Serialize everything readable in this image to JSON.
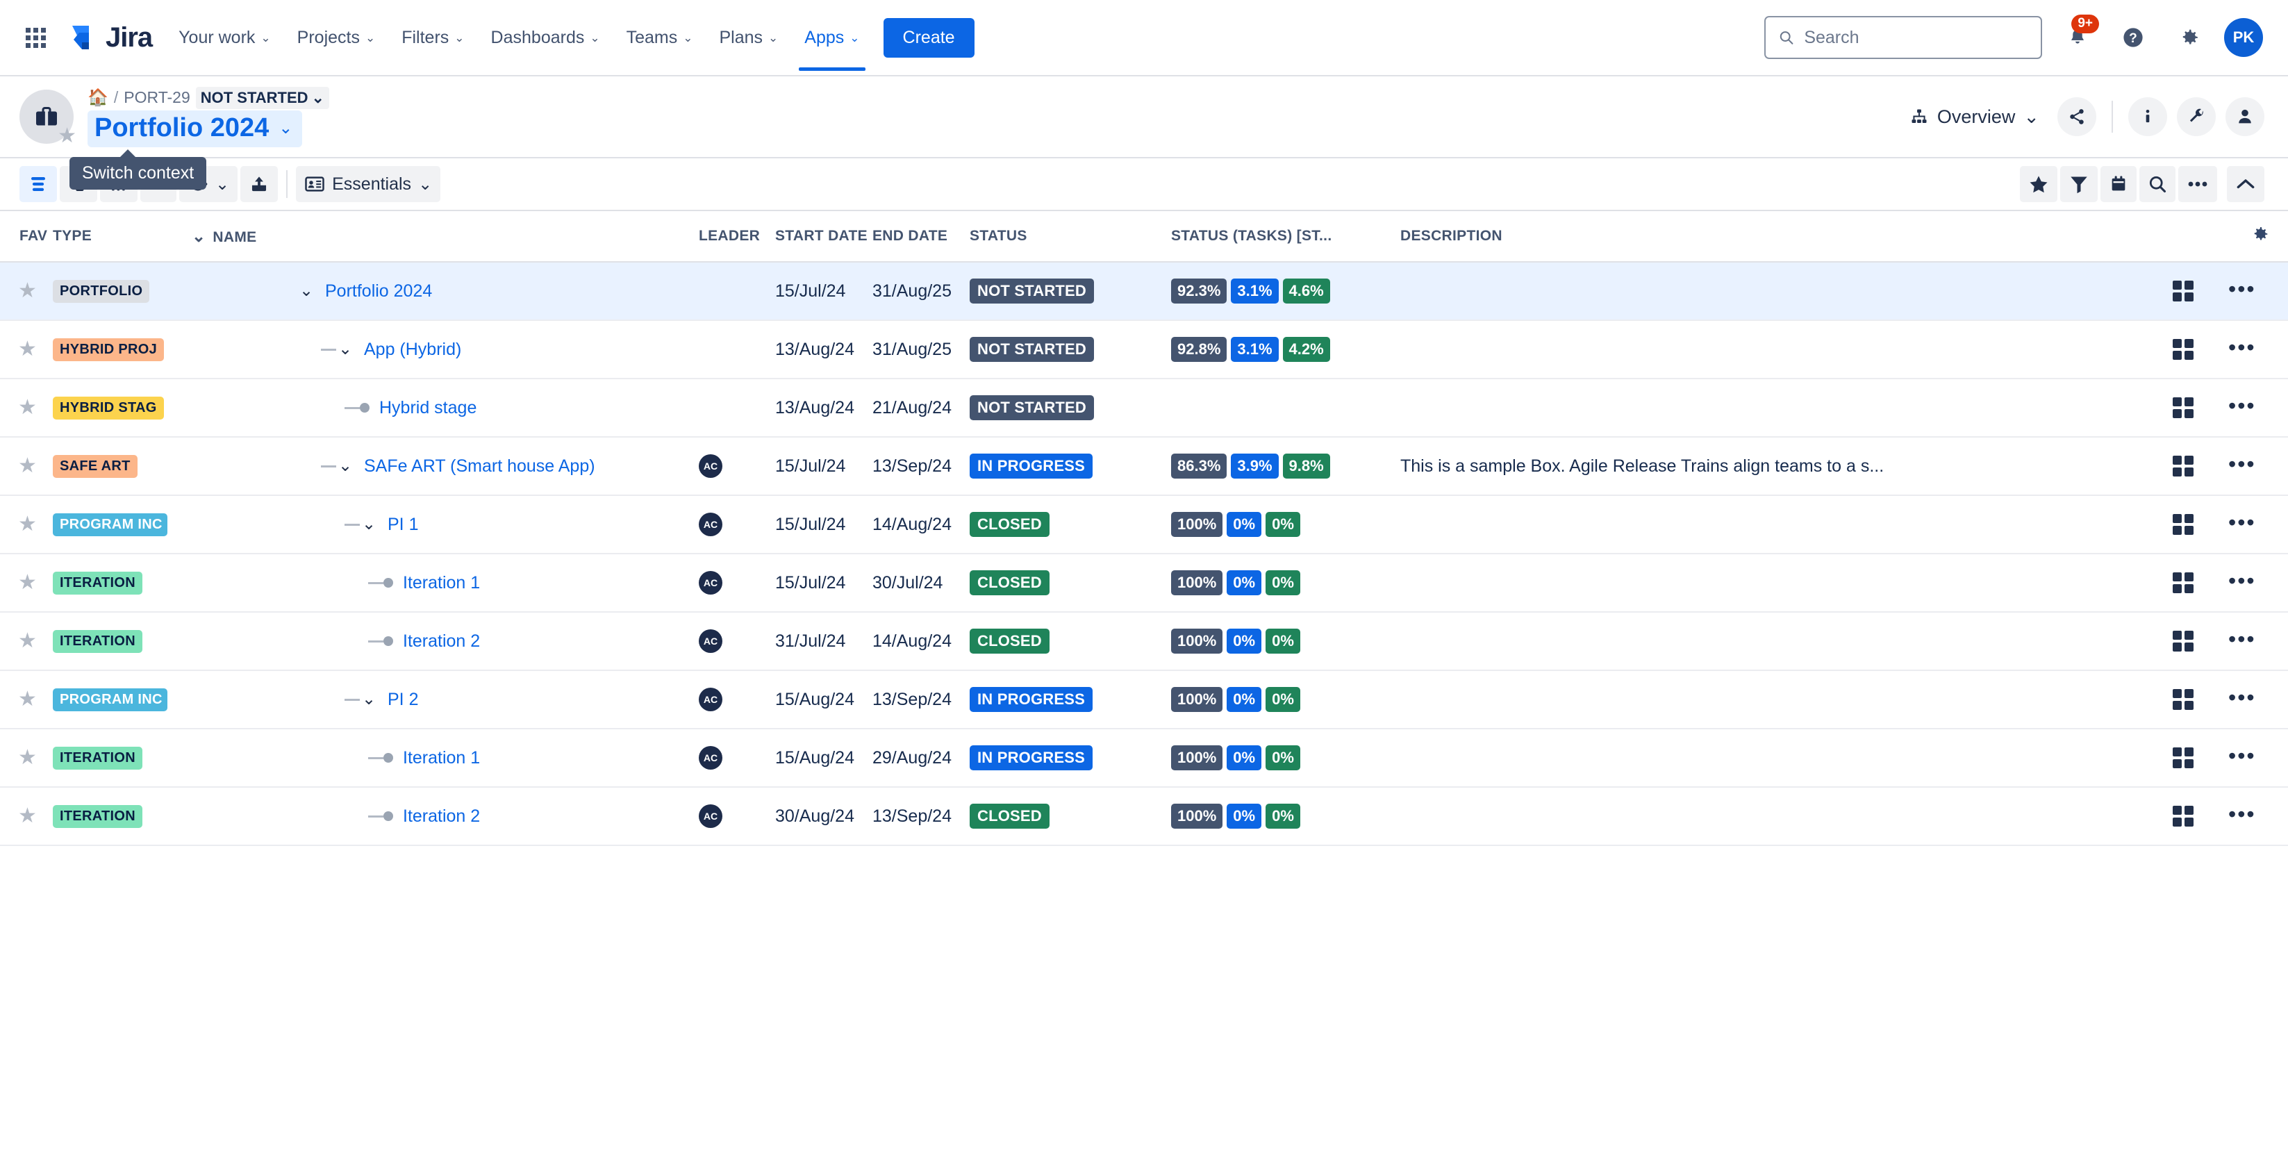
{
  "topnav": {
    "app_switcher_icon": "grid-apps-icon",
    "brand": "Jira",
    "items": [
      {
        "label": "Your work",
        "caret": "⌄",
        "active": false
      },
      {
        "label": "Projects",
        "caret": "⌄",
        "active": false
      },
      {
        "label": "Filters",
        "caret": "⌄",
        "active": false
      },
      {
        "label": "Dashboards",
        "caret": "⌄",
        "active": false
      },
      {
        "label": "Teams",
        "caret": "⌄",
        "active": false
      },
      {
        "label": "Plans",
        "caret": "⌄",
        "active": false
      },
      {
        "label": "Apps",
        "caret": "⌄",
        "active": true
      }
    ],
    "create_label": "Create",
    "search": {
      "placeholder": "Search",
      "value": ""
    },
    "notifications_badge": "9+",
    "avatar_initials": "PK",
    "accent_color": "#0c66e4",
    "badge_color": "#de350b"
  },
  "portfolio_header": {
    "breadcrumb": {
      "home_icon": "home-icon",
      "separator": "/",
      "key": "PORT-29",
      "status": "NOT STARTED",
      "status_caret": "⌄"
    },
    "title": "Portfolio 2024",
    "title_caret": "⌄",
    "view_selector": {
      "label": "Overview",
      "caret": "⌄",
      "icon": "org-chart-icon"
    },
    "actions": [
      {
        "name": "share-icon"
      },
      {
        "name": "info-icon"
      },
      {
        "name": "wrench-icon"
      },
      {
        "name": "person-icon"
      }
    ]
  },
  "toolbar": {
    "left_buttons": [
      {
        "name": "align-list-icon",
        "selected": true
      },
      {
        "name": "indent-list-icon",
        "selected": false
      },
      {
        "name": "columns-icon",
        "selected": false
      },
      {
        "name": "dropdown-caret",
        "selected": false
      },
      {
        "name": "eye-icon",
        "selected": false,
        "caret": "⌄"
      },
      {
        "name": "export-upload-icon",
        "selected": false
      }
    ],
    "essentials_label": "Essentials",
    "essentials_caret": "⌄",
    "essentials_icon": "card-id-icon",
    "right_buttons": [
      {
        "name": "star-icon"
      },
      {
        "name": "filter-funnel-icon"
      },
      {
        "name": "calendar-icon"
      },
      {
        "name": "search-icon"
      },
      {
        "name": "more-dots-icon"
      },
      {
        "name": "collapse-chevron-up-icon"
      }
    ],
    "tooltip": "Switch context"
  },
  "table": {
    "columns": [
      {
        "key": "fav",
        "label": "FAV"
      },
      {
        "key": "type",
        "label": "TYPE"
      },
      {
        "key": "name",
        "label": "NAME",
        "sort_caret": "⌄"
      },
      {
        "key": "leader",
        "label": "LEADER"
      },
      {
        "key": "start",
        "label": "START DATE"
      },
      {
        "key": "end",
        "label": "END DATE"
      },
      {
        "key": "status",
        "label": "STATUS"
      },
      {
        "key": "tasks",
        "label": "STATUS (TASKS) [ST..."
      },
      {
        "key": "desc",
        "label": "DESCRIPTION"
      }
    ],
    "settings_icon": "gear-icon",
    "rows": [
      {
        "fav": "★",
        "type": "PORTFOLIO",
        "type_bg": "#dcdfe4",
        "type_fg": "#091e42",
        "indent": 0,
        "expander": "⌄",
        "name": "Portfolio 2024",
        "leader": "",
        "start": "15/Jul/24",
        "end": "31/Aug/25",
        "status": "NOT STARTED",
        "status_bg": "#44546f",
        "tasks": [
          "92.3%",
          "3.1%",
          "4.6%"
        ],
        "desc": "",
        "selected": true
      },
      {
        "fav": "★",
        "type": "HYBRID PROJ",
        "type_bg": "#fcb68a",
        "type_fg": "#091e42",
        "indent": 1,
        "expander": "⌄",
        "name": "App (Hybrid)",
        "leader": "",
        "start": "13/Aug/24",
        "end": "31/Aug/25",
        "status": "NOT STARTED",
        "status_bg": "#44546f",
        "tasks": [
          "92.8%",
          "3.1%",
          "4.2%"
        ],
        "desc": "",
        "selected": false
      },
      {
        "fav": "★",
        "type": "HYBRID STAG",
        "type_bg": "#fcd34d",
        "type_fg": "#091e42",
        "indent": 2,
        "expander": "dot",
        "name": "Hybrid stage",
        "leader": "",
        "start": "13/Aug/24",
        "end": "21/Aug/24",
        "status": "NOT STARTED",
        "status_bg": "#44546f",
        "tasks": [],
        "desc": "",
        "selected": false
      },
      {
        "fav": "★",
        "type": "SAFE ART",
        "type_bg": "#fcb68a",
        "type_fg": "#091e42",
        "indent": 1,
        "expander": "⌄",
        "name": "SAFe ART (Smart house App)",
        "leader": "AC",
        "start": "15/Jul/24",
        "end": "13/Sep/24",
        "status": "IN PROGRESS",
        "status_bg": "#0c66e4",
        "tasks": [
          "86.3%",
          "3.9%",
          "9.8%"
        ],
        "desc": "This is a sample Box. Agile Release Trains align teams to a s...",
        "selected": false
      },
      {
        "fav": "★",
        "type": "PROGRAM INC",
        "type_bg": "#4bb6dd",
        "type_fg": "#ffffff",
        "indent": 2,
        "expander": "⌄",
        "name": "PI 1",
        "leader": "AC",
        "start": "15/Jul/24",
        "end": "14/Aug/24",
        "status": "CLOSED",
        "status_bg": "#1f845a",
        "tasks": [
          "100%",
          "0%",
          "0%"
        ],
        "desc": "",
        "selected": false
      },
      {
        "fav": "★",
        "type": "ITERATION",
        "type_bg": "#7ee2b8",
        "type_fg": "#091e42",
        "indent": 3,
        "expander": "dot",
        "name": "Iteration 1",
        "leader": "AC",
        "start": "15/Jul/24",
        "end": "30/Jul/24",
        "status": "CLOSED",
        "status_bg": "#1f845a",
        "tasks": [
          "100%",
          "0%",
          "0%"
        ],
        "desc": "",
        "selected": false
      },
      {
        "fav": "★",
        "type": "ITERATION",
        "type_bg": "#7ee2b8",
        "type_fg": "#091e42",
        "indent": 3,
        "expander": "dot",
        "name": "Iteration 2",
        "leader": "AC",
        "start": "31/Jul/24",
        "end": "14/Aug/24",
        "status": "CLOSED",
        "status_bg": "#1f845a",
        "tasks": [
          "100%",
          "0%",
          "0%"
        ],
        "desc": "",
        "selected": false
      },
      {
        "fav": "★",
        "type": "PROGRAM INC",
        "type_bg": "#4bb6dd",
        "type_fg": "#ffffff",
        "indent": 2,
        "expander": "⌄",
        "name": "PI 2",
        "leader": "AC",
        "start": "15/Aug/24",
        "end": "13/Sep/24",
        "status": "IN PROGRESS",
        "status_bg": "#0c66e4",
        "tasks": [
          "100%",
          "0%",
          "0%"
        ],
        "desc": "",
        "selected": false
      },
      {
        "fav": "★",
        "type": "ITERATION",
        "type_bg": "#7ee2b8",
        "type_fg": "#091e42",
        "indent": 3,
        "expander": "dot",
        "name": "Iteration 1",
        "leader": "AC",
        "start": "15/Aug/24",
        "end": "29/Aug/24",
        "status": "IN PROGRESS",
        "status_bg": "#0c66e4",
        "tasks": [
          "100%",
          "0%",
          "0%"
        ],
        "desc": "",
        "selected": false
      },
      {
        "fav": "★",
        "type": "ITERATION",
        "type_bg": "#7ee2b8",
        "type_fg": "#091e42",
        "indent": 3,
        "expander": "dot",
        "name": "Iteration 2",
        "leader": "AC",
        "start": "30/Aug/24",
        "end": "13/Sep/24",
        "status": "CLOSED",
        "status_bg": "#1f845a",
        "tasks": [
          "100%",
          "0%",
          "0%"
        ],
        "desc": "",
        "selected": false
      }
    ],
    "chip_colors": [
      "#44546f",
      "#0c66e4",
      "#1f845a"
    ],
    "row_actions": [
      {
        "name": "board-grid-icon"
      },
      {
        "name": "row-more-dots-icon"
      }
    ]
  }
}
